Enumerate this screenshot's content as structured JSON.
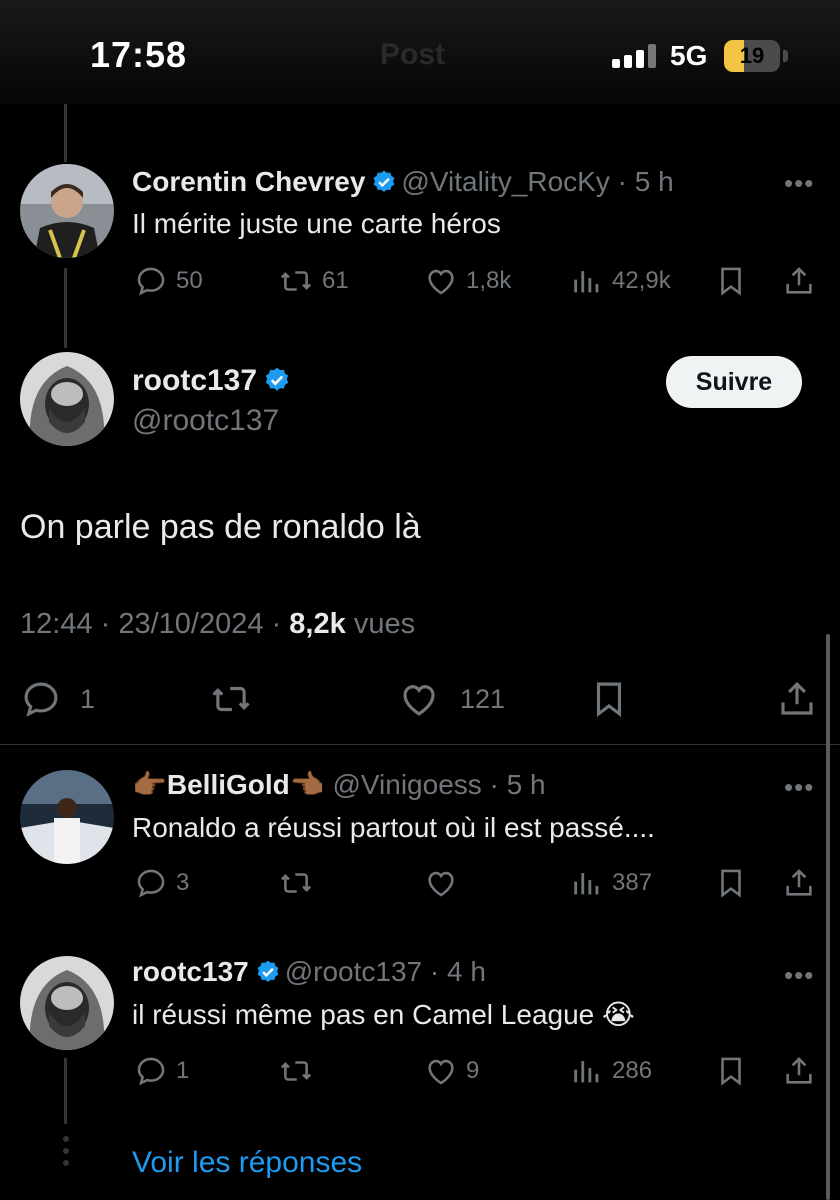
{
  "status_bar": {
    "time": "17:58",
    "network": "5G",
    "battery": "19",
    "battery_fraction": 0.35,
    "background_title": "Post"
  },
  "colors": {
    "accent": "#1d9bf0",
    "verified": "#1d9bf0",
    "muted": "#71767b",
    "battery": "#f4c542"
  },
  "replies_above": [
    {
      "name": "Corentin Chevrey",
      "handle": "@Vitality_RocKy",
      "time": "5 h",
      "text": "Il mérite juste une carte héros",
      "replies": "50",
      "reposts": "61",
      "likes": "1,8k",
      "views": "42,9k"
    }
  ],
  "main_post": {
    "name": "rootc137",
    "handle": "@rootc137",
    "follow_label": "Suivre",
    "text": "On parle pas de ronaldo là",
    "time": "12:44",
    "date": "23/10/2024",
    "views": "8,2k",
    "views_label": "vues",
    "replies": "1",
    "likes": "121"
  },
  "replies_below": [
    {
      "name_prefix_emoji": "👉🏾",
      "name": "BelliGold",
      "name_suffix_emoji": "👈🏾",
      "handle": "@Vinigoess",
      "time": "5 h",
      "text": "Ronaldo a réussi partout où il est passé....",
      "replies": "3",
      "views": "387"
    },
    {
      "name": "rootc137",
      "handle": "@rootc137",
      "time": "4 h",
      "text": "il réussi même pas en Camel League 😭",
      "replies": "1",
      "likes": "9",
      "views": "286"
    }
  ],
  "more_replies_label": "Voir les réponses",
  "icons": [
    "reply-icon",
    "repost-icon",
    "like-icon",
    "views-icon",
    "bookmark-icon",
    "share-icon",
    "verified-badge-icon",
    "more-icon"
  ]
}
